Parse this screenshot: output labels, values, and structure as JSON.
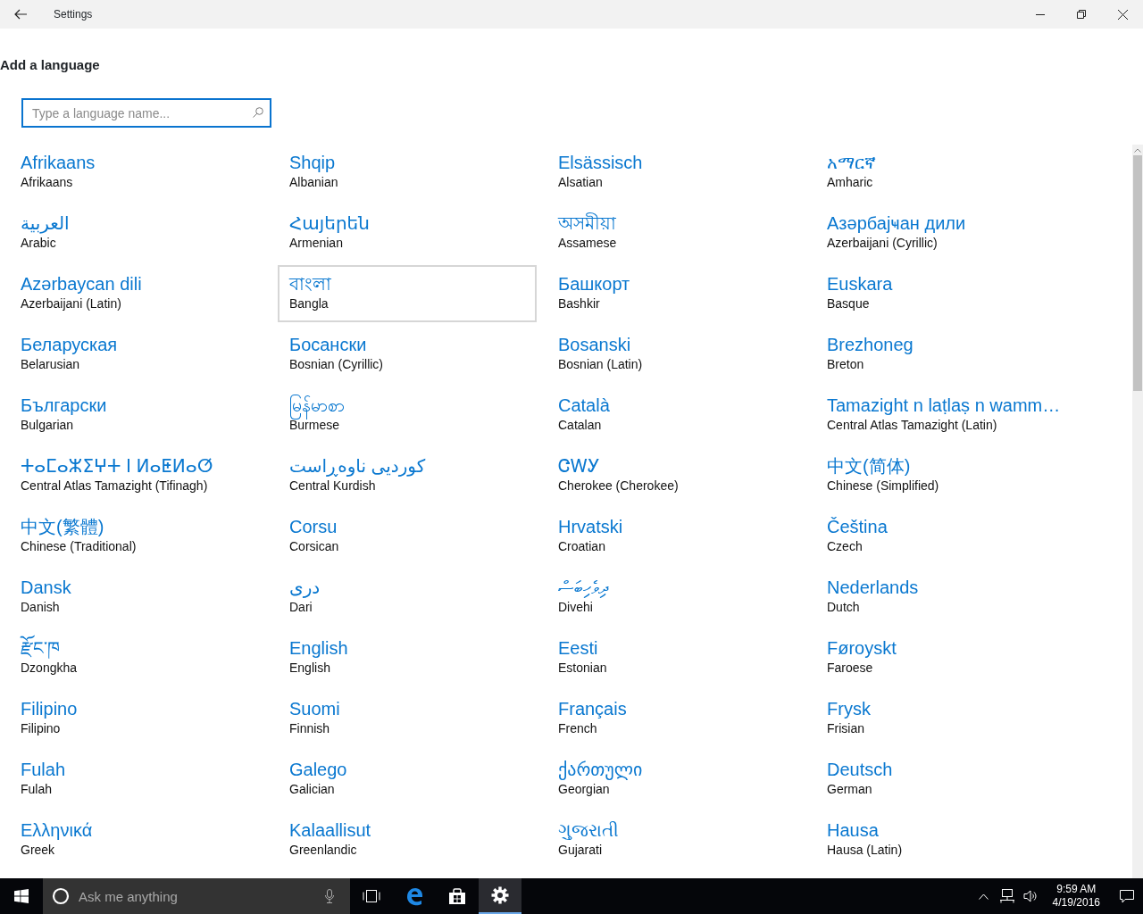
{
  "window": {
    "title": "Settings"
  },
  "page": {
    "heading": "Add a language",
    "search": {
      "placeholder": "Type a language name..."
    }
  },
  "languages": [
    {
      "native": "Afrikaans",
      "english": "Afrikaans",
      "selected": false
    },
    {
      "native": "Shqip",
      "english": "Albanian",
      "selected": false
    },
    {
      "native": "Elsässisch",
      "english": "Alsatian",
      "selected": false
    },
    {
      "native": "አማርኛ",
      "english": "Amharic",
      "selected": false
    },
    {
      "native": "العربية",
      "english": "Arabic",
      "selected": false
    },
    {
      "native": "Հայերեն",
      "english": "Armenian",
      "selected": false
    },
    {
      "native": "অসমীয়া",
      "english": "Assamese",
      "selected": false
    },
    {
      "native": "Азәрбајҹан дили",
      "english": "Azerbaijani (Cyrillic)",
      "selected": false
    },
    {
      "native": "Azərbaycan dili",
      "english": "Azerbaijani (Latin)",
      "selected": false
    },
    {
      "native": "বাংলা",
      "english": "Bangla",
      "selected": true
    },
    {
      "native": "Башкорт",
      "english": "Bashkir",
      "selected": false
    },
    {
      "native": "Euskara",
      "english": "Basque",
      "selected": false
    },
    {
      "native": "Беларуская",
      "english": "Belarusian",
      "selected": false
    },
    {
      "native": "Босански",
      "english": "Bosnian (Cyrillic)",
      "selected": false
    },
    {
      "native": "Bosanski",
      "english": "Bosnian (Latin)",
      "selected": false
    },
    {
      "native": "Brezhoneg",
      "english": "Breton",
      "selected": false
    },
    {
      "native": "Български",
      "english": "Bulgarian",
      "selected": false
    },
    {
      "native": "မြန်မာစာ",
      "english": "Burmese",
      "selected": false
    },
    {
      "native": "Català",
      "english": "Catalan",
      "selected": false
    },
    {
      "native": "Tamazight n laṭlaṣ n wamm…",
      "english": "Central Atlas Tamazight (Latin)",
      "selected": false
    },
    {
      "native": "ⵜⴰⵎⴰⵣⵉⵖⵜ ⵏ ⵍⴰⵟⵍⴰⵚ",
      "english": "Central Atlas Tamazight (Tifinagh)",
      "selected": false
    },
    {
      "native": "کوردیی ناوەڕاست",
      "english": "Central Kurdish",
      "selected": false
    },
    {
      "native": "ᏣᎳᎩ",
      "english": "Cherokee (Cherokee)",
      "selected": false
    },
    {
      "native": "中文(简体)",
      "english": "Chinese (Simplified)",
      "selected": false
    },
    {
      "native": "中文(繁體)",
      "english": "Chinese (Traditional)",
      "selected": false
    },
    {
      "native": "Corsu",
      "english": "Corsican",
      "selected": false
    },
    {
      "native": "Hrvatski",
      "english": "Croatian",
      "selected": false
    },
    {
      "native": "Čeština",
      "english": "Czech",
      "selected": false
    },
    {
      "native": "Dansk",
      "english": "Danish",
      "selected": false
    },
    {
      "native": "دری",
      "english": "Dari",
      "selected": false
    },
    {
      "native": "ދިވެހިބަސް",
      "english": "Divehi",
      "selected": false
    },
    {
      "native": "Nederlands",
      "english": "Dutch",
      "selected": false
    },
    {
      "native": "རྫོང་ཁ",
      "english": "Dzongkha",
      "selected": false
    },
    {
      "native": "English",
      "english": "English",
      "selected": false
    },
    {
      "native": "Eesti",
      "english": "Estonian",
      "selected": false
    },
    {
      "native": "Føroyskt",
      "english": "Faroese",
      "selected": false
    },
    {
      "native": "Filipino",
      "english": "Filipino",
      "selected": false
    },
    {
      "native": "Suomi",
      "english": "Finnish",
      "selected": false
    },
    {
      "native": "Français",
      "english": "French",
      "selected": false
    },
    {
      "native": "Frysk",
      "english": "Frisian",
      "selected": false
    },
    {
      "native": "Fulah",
      "english": "Fulah",
      "selected": false
    },
    {
      "native": "Galego",
      "english": "Galician",
      "selected": false
    },
    {
      "native": "ქართული",
      "english": "Georgian",
      "selected": false
    },
    {
      "native": "Deutsch",
      "english": "German",
      "selected": false
    },
    {
      "native": "Ελληνικά",
      "english": "Greek",
      "selected": false
    },
    {
      "native": "Kalaallisut",
      "english": "Greenlandic",
      "selected": false
    },
    {
      "native": "ગુજરાતી",
      "english": "Gujarati",
      "selected": false
    },
    {
      "native": "Hausa",
      "english": "Hausa (Latin)",
      "selected": false
    }
  ],
  "taskbar": {
    "search_placeholder": "Ask me anything",
    "apps": [
      {
        "kind": "taskview",
        "selected": false
      },
      {
        "kind": "edge",
        "selected": false
      },
      {
        "kind": "store",
        "selected": false
      },
      {
        "kind": "settings",
        "selected": true
      }
    ],
    "clock": {
      "time": "9:59 AM",
      "date": "4/19/2016"
    }
  }
}
